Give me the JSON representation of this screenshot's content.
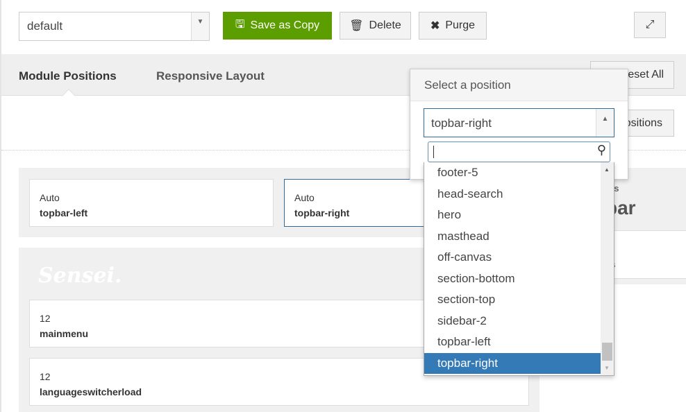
{
  "toolbar": {
    "layout_select": "default",
    "save_copy": "Save as Copy",
    "delete": "Delete",
    "purge": "Purge"
  },
  "tabs": [
    {
      "label": "Module Positions",
      "active": true
    },
    {
      "label": "Responsive Layout",
      "active": false
    }
  ],
  "right_buttons": {
    "reset_all_visible": "eset All",
    "positions_visible": "ositions"
  },
  "row1": [
    {
      "size": "Auto",
      "name": "topbar-left"
    },
    {
      "size": "Auto",
      "name": "topbar-right"
    }
  ],
  "logo": "Sensei.",
  "row2": [
    {
      "size": "12",
      "name": "mainmenu"
    },
    {
      "size": "12",
      "name": "languageswitcherload"
    }
  ],
  "side": {
    "label_fragment": "as",
    "title_fragment": "bar",
    "card_fragment": "vas"
  },
  "dropdown": {
    "title": "Select a position",
    "selected": "topbar-right",
    "search_value": "",
    "options": [
      "footer-5",
      "head-search",
      "hero",
      "masthead",
      "off-canvas",
      "section-bottom",
      "section-top",
      "sidebar-2",
      "topbar-left",
      "topbar-right"
    ],
    "highlighted": "topbar-right"
  },
  "colors": {
    "accent": "#5c9e00",
    "highlight": "#337ab7"
  }
}
